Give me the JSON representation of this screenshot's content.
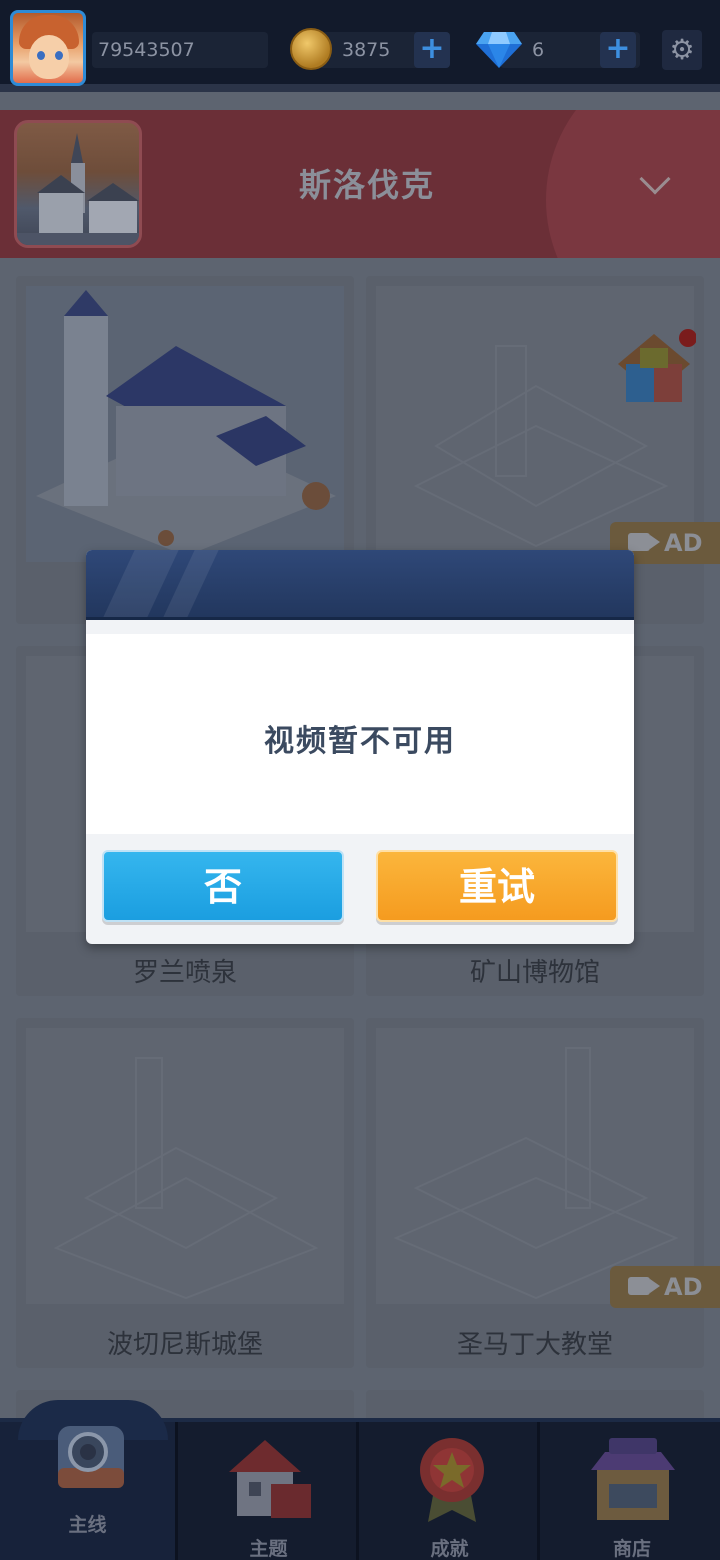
{
  "topbar": {
    "user_id": "79543507",
    "coins": "3875",
    "gems": "6"
  },
  "region": {
    "title": "斯洛伐克"
  },
  "levels": [
    {
      "name": ""
    },
    {
      "name": "",
      "ad": "AD"
    },
    {
      "name": "罗兰喷泉"
    },
    {
      "name": "矿山博物馆"
    },
    {
      "name": "波切尼斯城堡"
    },
    {
      "name": "圣马丁大教堂",
      "ad": "AD"
    }
  ],
  "modal": {
    "message": "视频暂不可用",
    "no_label": "否",
    "retry_label": "重试"
  },
  "bottom_nav": {
    "items": [
      {
        "label": "主线"
      },
      {
        "label": "主题"
      },
      {
        "label": "成就"
      },
      {
        "label": "商店"
      }
    ]
  },
  "colors": {
    "no_button": "#1b9ee0",
    "retry_button": "#f59b1f",
    "modal_header": "#22375e",
    "topbar": "#121a2b"
  },
  "icons": [
    "avatar",
    "coin-icon",
    "plus-icon",
    "gem-icon",
    "gear-icon",
    "chevron-down-icon",
    "puzzle-icon",
    "video-camera-icon",
    "home-nav-icon",
    "theme-house-icon",
    "achievement-medal-icon",
    "shop-icon"
  ]
}
